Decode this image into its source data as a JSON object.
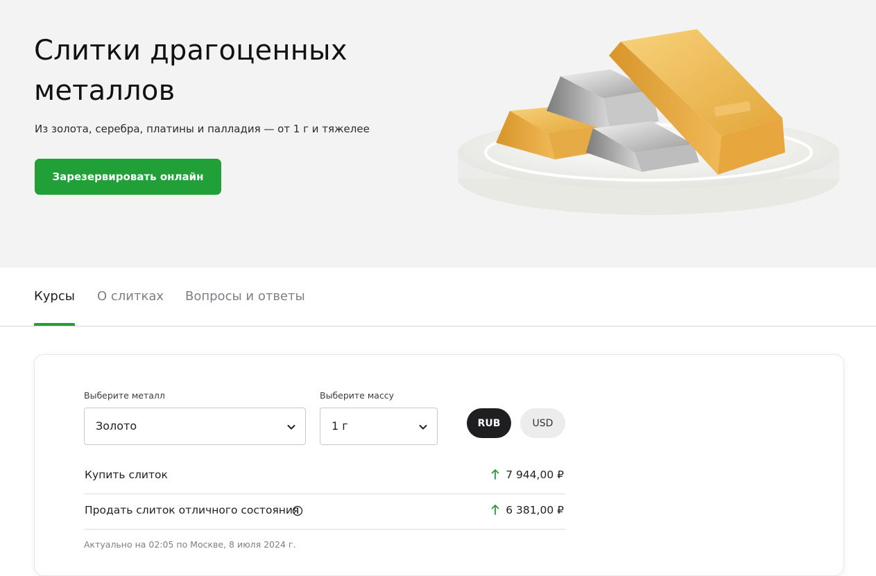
{
  "hero": {
    "title": "Слитки драгоценных металлов",
    "subtitle": "Из золота, серебра, платины и палладия — от 1 г и тяжелее",
    "cta_label": "Зарезервировать онлайн"
  },
  "tabs": [
    {
      "label": "Курсы",
      "active": true
    },
    {
      "label": "О слитках",
      "active": false
    },
    {
      "label": "Вопросы и ответы",
      "active": false
    }
  ],
  "calculator": {
    "metal_label": "Выберите металл",
    "metal_value": "Золото",
    "mass_label": "Выберите массу",
    "mass_value": "1 г",
    "currencies": [
      {
        "label": "RUB",
        "selected": true
      },
      {
        "label": "USD",
        "selected": false
      }
    ],
    "rows": [
      {
        "label": "Купить слиток",
        "value": "7 944,00 ₽",
        "trend": "up",
        "info": false
      },
      {
        "label": "Продать слиток отличного состояния",
        "value": "6 381,00 ₽",
        "trend": "up",
        "info": true
      }
    ],
    "updated": "Актуально на 02:05 по Москве, 8 июля 2024 г."
  },
  "colors": {
    "accent": "#21a038",
    "hero_bg": "#f3f3f3",
    "dark": "#1f1f22",
    "trend_up": "#21a038"
  },
  "icons": {
    "select_chevron": "chevron-down-icon",
    "trend": "arrow-up-icon",
    "info": "info-icon"
  }
}
